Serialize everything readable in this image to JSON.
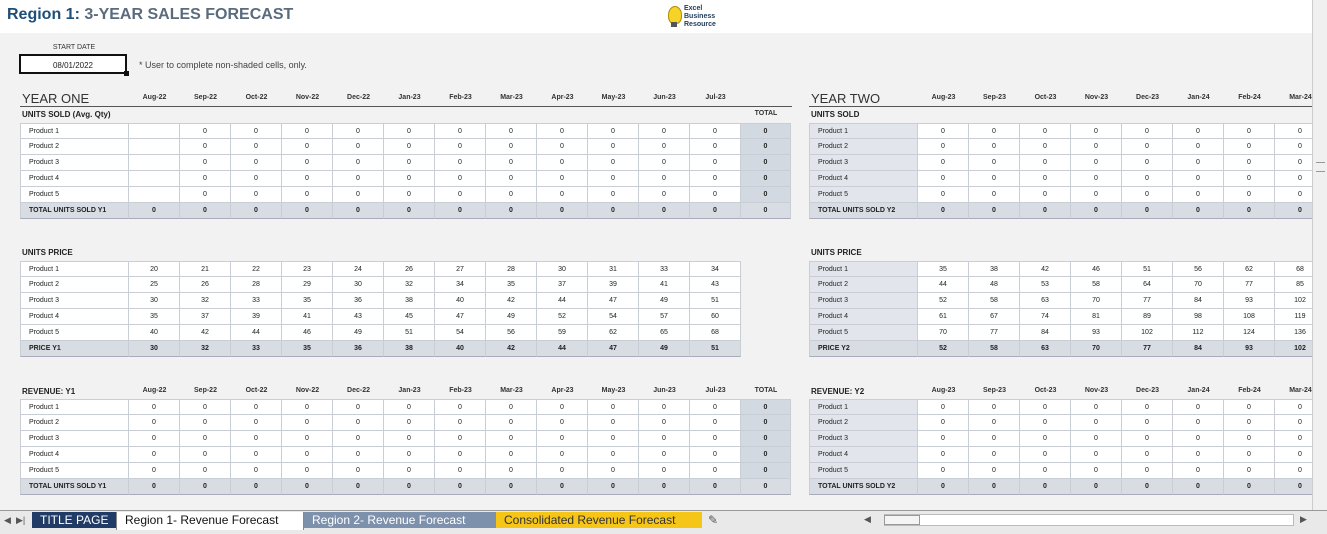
{
  "title": {
    "region": "Region 1:",
    "rest": "3-YEAR SALES FORECAST"
  },
  "logo": {
    "line1": "Excel",
    "line2": "Business",
    "line3": "Resource"
  },
  "start_date": {
    "label": "START DATE",
    "value": "08/01/2022"
  },
  "note": "* User to complete non-shaded cells, only.",
  "year_one": {
    "heading": "YEAR ONE",
    "months": [
      "Aug-22",
      "Sep-22",
      "Oct-22",
      "Nov-22",
      "Dec-22",
      "Jan-23",
      "Feb-23",
      "Mar-23",
      "Apr-23",
      "May-23",
      "Jun-23",
      "Jul-23"
    ],
    "total_label": "TOTAL",
    "units": {
      "label": "UNITS SOLD (Avg. Qty)",
      "rows": [
        {
          "name": "Product 1",
          "values": [
            "",
            "0",
            "0",
            "0",
            "0",
            "0",
            "0",
            "0",
            "0",
            "0",
            "0",
            "0"
          ],
          "total": "0"
        },
        {
          "name": "Product 2",
          "values": [
            "",
            "0",
            "0",
            "0",
            "0",
            "0",
            "0",
            "0",
            "0",
            "0",
            "0",
            "0"
          ],
          "total": "0"
        },
        {
          "name": "Product 3",
          "values": [
            "",
            "0",
            "0",
            "0",
            "0",
            "0",
            "0",
            "0",
            "0",
            "0",
            "0",
            "0"
          ],
          "total": "0"
        },
        {
          "name": "Product 4",
          "values": [
            "",
            "0",
            "0",
            "0",
            "0",
            "0",
            "0",
            "0",
            "0",
            "0",
            "0",
            "0"
          ],
          "total": "0"
        },
        {
          "name": "Product 5",
          "values": [
            "",
            "0",
            "0",
            "0",
            "0",
            "0",
            "0",
            "0",
            "0",
            "0",
            "0",
            "0"
          ],
          "total": "0"
        }
      ],
      "summary": {
        "name": "TOTAL UNITS SOLD Y1",
        "values": [
          "0",
          "0",
          "0",
          "0",
          "0",
          "0",
          "0",
          "0",
          "0",
          "0",
          "0",
          "0"
        ],
        "total": "0"
      }
    },
    "price": {
      "label": "UNITS PRICE",
      "rows": [
        {
          "name": "Product 1",
          "values": [
            "20",
            "21",
            "22",
            "23",
            "24",
            "26",
            "27",
            "28",
            "30",
            "31",
            "33",
            "34"
          ]
        },
        {
          "name": "Product 2",
          "values": [
            "25",
            "26",
            "28",
            "29",
            "30",
            "32",
            "34",
            "35",
            "37",
            "39",
            "41",
            "43"
          ]
        },
        {
          "name": "Product 3",
          "values": [
            "30",
            "32",
            "33",
            "35",
            "36",
            "38",
            "40",
            "42",
            "44",
            "47",
            "49",
            "51"
          ]
        },
        {
          "name": "Product 4",
          "values": [
            "35",
            "37",
            "39",
            "41",
            "43",
            "45",
            "47",
            "49",
            "52",
            "54",
            "57",
            "60"
          ]
        },
        {
          "name": "Product 5",
          "values": [
            "40",
            "42",
            "44",
            "46",
            "49",
            "51",
            "54",
            "56",
            "59",
            "62",
            "65",
            "68"
          ]
        }
      ],
      "summary": {
        "name": "PRICE Y1",
        "values": [
          "30",
          "32",
          "33",
          "35",
          "36",
          "38",
          "40",
          "42",
          "44",
          "47",
          "49",
          "51"
        ]
      }
    },
    "revenue": {
      "label": "REVENUE: Y1",
      "rows": [
        {
          "name": "Product 1",
          "values": [
            "0",
            "0",
            "0",
            "0",
            "0",
            "0",
            "0",
            "0",
            "0",
            "0",
            "0",
            "0"
          ],
          "total": "0"
        },
        {
          "name": "Product 2",
          "values": [
            "0",
            "0",
            "0",
            "0",
            "0",
            "0",
            "0",
            "0",
            "0",
            "0",
            "0",
            "0"
          ],
          "total": "0"
        },
        {
          "name": "Product 3",
          "values": [
            "0",
            "0",
            "0",
            "0",
            "0",
            "0",
            "0",
            "0",
            "0",
            "0",
            "0",
            "0"
          ],
          "total": "0"
        },
        {
          "name": "Product 4",
          "values": [
            "0",
            "0",
            "0",
            "0",
            "0",
            "0",
            "0",
            "0",
            "0",
            "0",
            "0",
            "0"
          ],
          "total": "0"
        },
        {
          "name": "Product 5",
          "values": [
            "0",
            "0",
            "0",
            "0",
            "0",
            "0",
            "0",
            "0",
            "0",
            "0",
            "0",
            "0"
          ],
          "total": "0"
        }
      ],
      "summary": {
        "name": "TOTAL UNITS SOLD Y1",
        "values": [
          "0",
          "0",
          "0",
          "0",
          "0",
          "0",
          "0",
          "0",
          "0",
          "0",
          "0",
          "0"
        ],
        "total": "0"
      }
    }
  },
  "year_two": {
    "heading": "YEAR TWO",
    "months": [
      "Aug-23",
      "Sep-23",
      "Oct-23",
      "Nov-23",
      "Dec-23",
      "Jan-24",
      "Feb-24",
      "Mar-24"
    ],
    "units": {
      "label": "UNITS SOLD",
      "rows": [
        {
          "name": "Product 1",
          "values": [
            "0",
            "0",
            "0",
            "0",
            "0",
            "0",
            "0",
            "0"
          ]
        },
        {
          "name": "Product 2",
          "values": [
            "0",
            "0",
            "0",
            "0",
            "0",
            "0",
            "0",
            "0"
          ]
        },
        {
          "name": "Product 3",
          "values": [
            "0",
            "0",
            "0",
            "0",
            "0",
            "0",
            "0",
            "0"
          ]
        },
        {
          "name": "Product 4",
          "values": [
            "0",
            "0",
            "0",
            "0",
            "0",
            "0",
            "0",
            "0"
          ]
        },
        {
          "name": "Product 5",
          "values": [
            "0",
            "0",
            "0",
            "0",
            "0",
            "0",
            "0",
            "0"
          ]
        }
      ],
      "summary": {
        "name": "TOTAL UNITS SOLD Y2",
        "values": [
          "0",
          "0",
          "0",
          "0",
          "0",
          "0",
          "0",
          "0"
        ]
      }
    },
    "price": {
      "label": "UNITS PRICE",
      "rows": [
        {
          "name": "Product 1",
          "values": [
            "35",
            "38",
            "42",
            "46",
            "51",
            "56",
            "62",
            "68"
          ]
        },
        {
          "name": "Product 2",
          "values": [
            "44",
            "48",
            "53",
            "58",
            "64",
            "70",
            "77",
            "85"
          ]
        },
        {
          "name": "Product 3",
          "values": [
            "52",
            "58",
            "63",
            "70",
            "77",
            "84",
            "93",
            "102"
          ]
        },
        {
          "name": "Product 4",
          "values": [
            "61",
            "67",
            "74",
            "81",
            "89",
            "98",
            "108",
            "119"
          ]
        },
        {
          "name": "Product 5",
          "values": [
            "70",
            "77",
            "84",
            "93",
            "102",
            "112",
            "124",
            "136"
          ]
        }
      ],
      "summary": {
        "name": "PRICE Y2",
        "values": [
          "52",
          "58",
          "63",
          "70",
          "77",
          "84",
          "93",
          "102"
        ]
      }
    },
    "revenue": {
      "label": "REVENUE: Y2",
      "rows": [
        {
          "name": "Product 1",
          "values": [
            "0",
            "0",
            "0",
            "0",
            "0",
            "0",
            "0",
            "0"
          ]
        },
        {
          "name": "Product 2",
          "values": [
            "0",
            "0",
            "0",
            "0",
            "0",
            "0",
            "0",
            "0"
          ]
        },
        {
          "name": "Product 3",
          "values": [
            "0",
            "0",
            "0",
            "0",
            "0",
            "0",
            "0",
            "0"
          ]
        },
        {
          "name": "Product 4",
          "values": [
            "0",
            "0",
            "0",
            "0",
            "0",
            "0",
            "0",
            "0"
          ]
        },
        {
          "name": "Product 5",
          "values": [
            "0",
            "0",
            "0",
            "0",
            "0",
            "0",
            "0",
            "0"
          ]
        }
      ],
      "summary": {
        "name": "TOTAL UNITS SOLD Y2",
        "values": [
          "0",
          "0",
          "0",
          "0",
          "0",
          "0",
          "0",
          "0"
        ]
      }
    }
  },
  "tabs": [
    {
      "label": "TITLE PAGE"
    },
    {
      "label": "Region 1- Revenue Forecast"
    },
    {
      "label": "Region 2- Revenue Forecast"
    },
    {
      "label": "Consolidated Revenue Forecast"
    }
  ],
  "tab_nav": {
    "prev": "◀",
    "next": "▶",
    "last": "▶|"
  }
}
